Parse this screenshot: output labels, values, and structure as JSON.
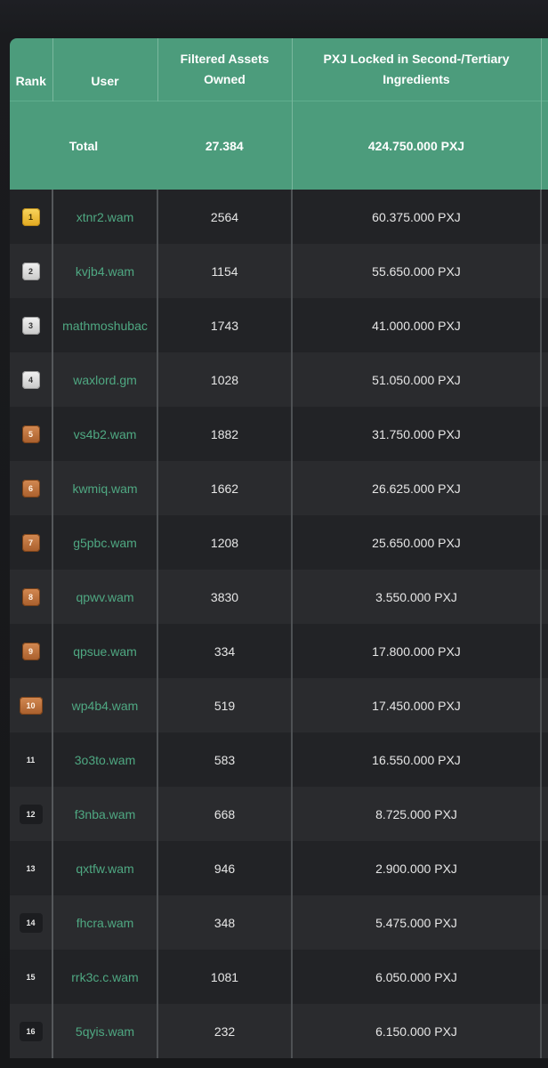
{
  "table": {
    "headers": {
      "rank": "Rank",
      "user": "User",
      "assets": "Filtered Assets Owned",
      "pxj": "PXJ Locked in Second-/Tertiary Ingredients"
    },
    "total": {
      "label": "Total",
      "assets": "27.384",
      "pxj": "424.750.000 PXJ"
    },
    "rows": [
      {
        "rank": "1",
        "medal": "gold",
        "user": "xtnr2.wam",
        "assets": "2564",
        "pxj": "60.375.000 PXJ"
      },
      {
        "rank": "2",
        "medal": "silver",
        "user": "kvjb4.wam",
        "assets": "1154",
        "pxj": "55.650.000 PXJ"
      },
      {
        "rank": "3",
        "medal": "silver",
        "user": "mathmoshubac",
        "assets": "1743",
        "pxj": "41.000.000 PXJ"
      },
      {
        "rank": "4",
        "medal": "silver",
        "user": "waxlord.gm",
        "assets": "1028",
        "pxj": "51.050.000 PXJ"
      },
      {
        "rank": "5",
        "medal": "bronze",
        "user": "vs4b2.wam",
        "assets": "1882",
        "pxj": "31.750.000 PXJ"
      },
      {
        "rank": "6",
        "medal": "bronze",
        "user": "kwmiq.wam",
        "assets": "1662",
        "pxj": "26.625.000 PXJ"
      },
      {
        "rank": "7",
        "medal": "bronze",
        "user": "g5pbc.wam",
        "assets": "1208",
        "pxj": "25.650.000 PXJ"
      },
      {
        "rank": "8",
        "medal": "bronze",
        "user": "qpwv.wam",
        "assets": "3830",
        "pxj": "3.550.000 PXJ"
      },
      {
        "rank": "9",
        "medal": "bronze",
        "user": "qpsue.wam",
        "assets": "334",
        "pxj": "17.800.000 PXJ"
      },
      {
        "rank": "10",
        "medal": "bronze",
        "user": "wp4b4.wam",
        "assets": "519",
        "pxj": "17.450.000 PXJ"
      },
      {
        "rank": "11",
        "medal": "none",
        "user": "3o3to.wam",
        "assets": "583",
        "pxj": "16.550.000 PXJ"
      },
      {
        "rank": "12",
        "medal": "none",
        "user": "f3nba.wam",
        "assets": "668",
        "pxj": "8.725.000 PXJ"
      },
      {
        "rank": "13",
        "medal": "none",
        "user": "qxtfw.wam",
        "assets": "946",
        "pxj": "2.900.000 PXJ"
      },
      {
        "rank": "14",
        "medal": "none",
        "user": "fhcra.wam",
        "assets": "348",
        "pxj": "5.475.000 PXJ"
      },
      {
        "rank": "15",
        "medal": "none",
        "user": "rrk3c.c.wam",
        "assets": "1081",
        "pxj": "6.050.000 PXJ"
      },
      {
        "rank": "16",
        "medal": "none",
        "user": "5qyis.wam",
        "assets": "232",
        "pxj": "6.150.000 PXJ"
      }
    ]
  },
  "colors": {
    "header_green": "#4c9c7c",
    "user_link_green": "#4fa882",
    "row_dark": "#222326",
    "row_light": "#2a2b2e",
    "medal_gold": "#e8b62c",
    "medal_silver": "#dcdcdc",
    "medal_bronze": "#bd743e"
  }
}
